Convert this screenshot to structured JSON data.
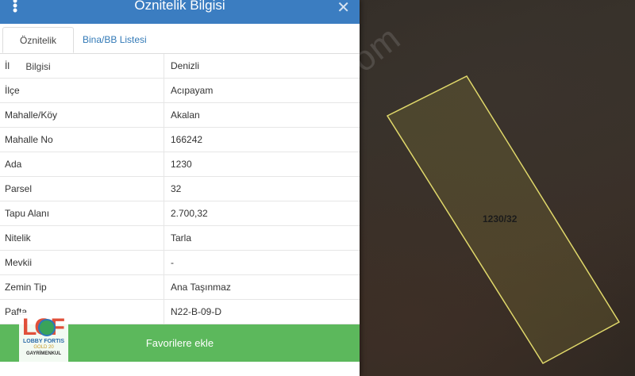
{
  "header": {
    "title": "Öznitelik Bilgisi",
    "menu_icon": "more-vertical-icon",
    "close_icon": "close-icon",
    "close_glyph": "✕"
  },
  "tabs": [
    {
      "label": "Öznitelik Bilgisi",
      "active": true
    },
    {
      "label": "Bina/BB Listesi",
      "active": false
    }
  ],
  "attributes": [
    {
      "key": "İl",
      "value": "Denizli"
    },
    {
      "key": "İlçe",
      "value": "Acıpayam"
    },
    {
      "key": "Mahalle/Köy",
      "value": "Akalan"
    },
    {
      "key": "Mahalle No",
      "value": "166242"
    },
    {
      "key": "Ada",
      "value": "1230"
    },
    {
      "key": "Parsel",
      "value": "32"
    },
    {
      "key": "Tapu Alanı",
      "value": "2.700,32"
    },
    {
      "key": "Nitelik",
      "value": "Tarla"
    },
    {
      "key": "Mevkii",
      "value": "-"
    },
    {
      "key": "Zemin Tip",
      "value": "Ana Taşınmaz"
    },
    {
      "key": "Pafta",
      "value": "N22-B-09-D"
    }
  ],
  "favorite_button": {
    "label": "Favorilere ekle"
  },
  "map": {
    "parcel_label": "1230/32",
    "watermark": "emlakjet.com",
    "parcel_color": "#e0d86a"
  },
  "logo": {
    "mark": "LOF",
    "line1": "LOBBY FORTIS",
    "line2": "GOLD 20",
    "line3": "GAYRİMENKUL"
  },
  "colors": {
    "header": "#3b7dc1",
    "favorite": "#5cb85c",
    "link": "#337ab7"
  }
}
